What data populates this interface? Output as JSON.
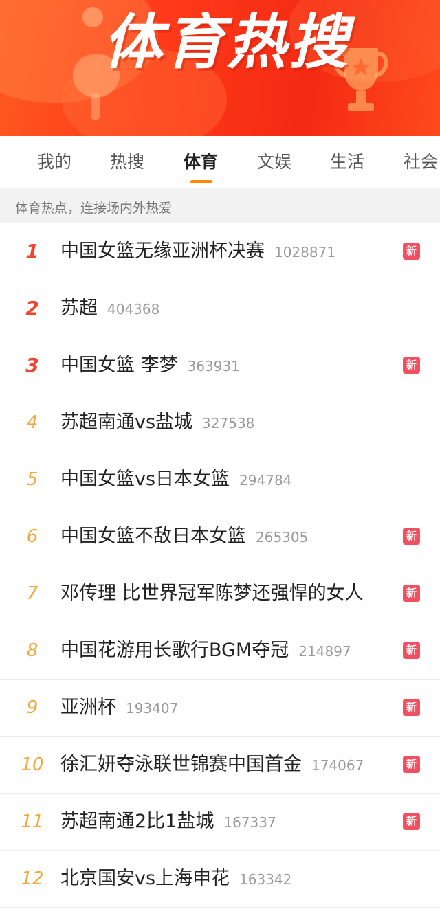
{
  "banner": {
    "title": "体育热搜"
  },
  "tabs": [
    {
      "label": "我的"
    },
    {
      "label": "热搜"
    },
    {
      "label": "体育"
    },
    {
      "label": "文娱"
    },
    {
      "label": "生活"
    },
    {
      "label": "社会"
    }
  ],
  "active_tab": "体育",
  "subtitle": "体育热点，连接场内外热爱",
  "badge_label": "新",
  "colors": {
    "banner": "#f42a12",
    "accent_underline": "#ff8a00",
    "top_rank": "#f04530",
    "rank": "#f3a73c",
    "new_badge": "#f0505f"
  },
  "items": [
    {
      "rank": "1",
      "title": "中国女篮无缘亚洲杯决赛",
      "count": "1028871",
      "new": true
    },
    {
      "rank": "2",
      "title": "苏超",
      "count": "404368",
      "new": false
    },
    {
      "rank": "3",
      "title": "中国女篮 李梦",
      "count": "363931",
      "new": true
    },
    {
      "rank": "4",
      "title": "苏超南通vs盐城",
      "count": "327538",
      "new": false
    },
    {
      "rank": "5",
      "title": "中国女篮vs日本女篮",
      "count": "294784",
      "new": false
    },
    {
      "rank": "6",
      "title": "中国女篮不敌日本女篮",
      "count": "265305",
      "new": true
    },
    {
      "rank": "7",
      "title": "邓传理 比世界冠军陈梦还强悍的女人",
      "count": "",
      "new": true
    },
    {
      "rank": "8",
      "title": "中国花游用长歌行BGM夺冠",
      "count": "214897",
      "new": true
    },
    {
      "rank": "9",
      "title": "亚洲杯",
      "count": "193407",
      "new": true
    },
    {
      "rank": "10",
      "title": "徐汇妍夺泳联世锦赛中国首金",
      "count": "174067",
      "new": true
    },
    {
      "rank": "11",
      "title": "苏超南通2比1盐城",
      "count": "167337",
      "new": true
    },
    {
      "rank": "12",
      "title": "北京国安vs上海申花",
      "count": "163342",
      "new": false
    }
  ]
}
